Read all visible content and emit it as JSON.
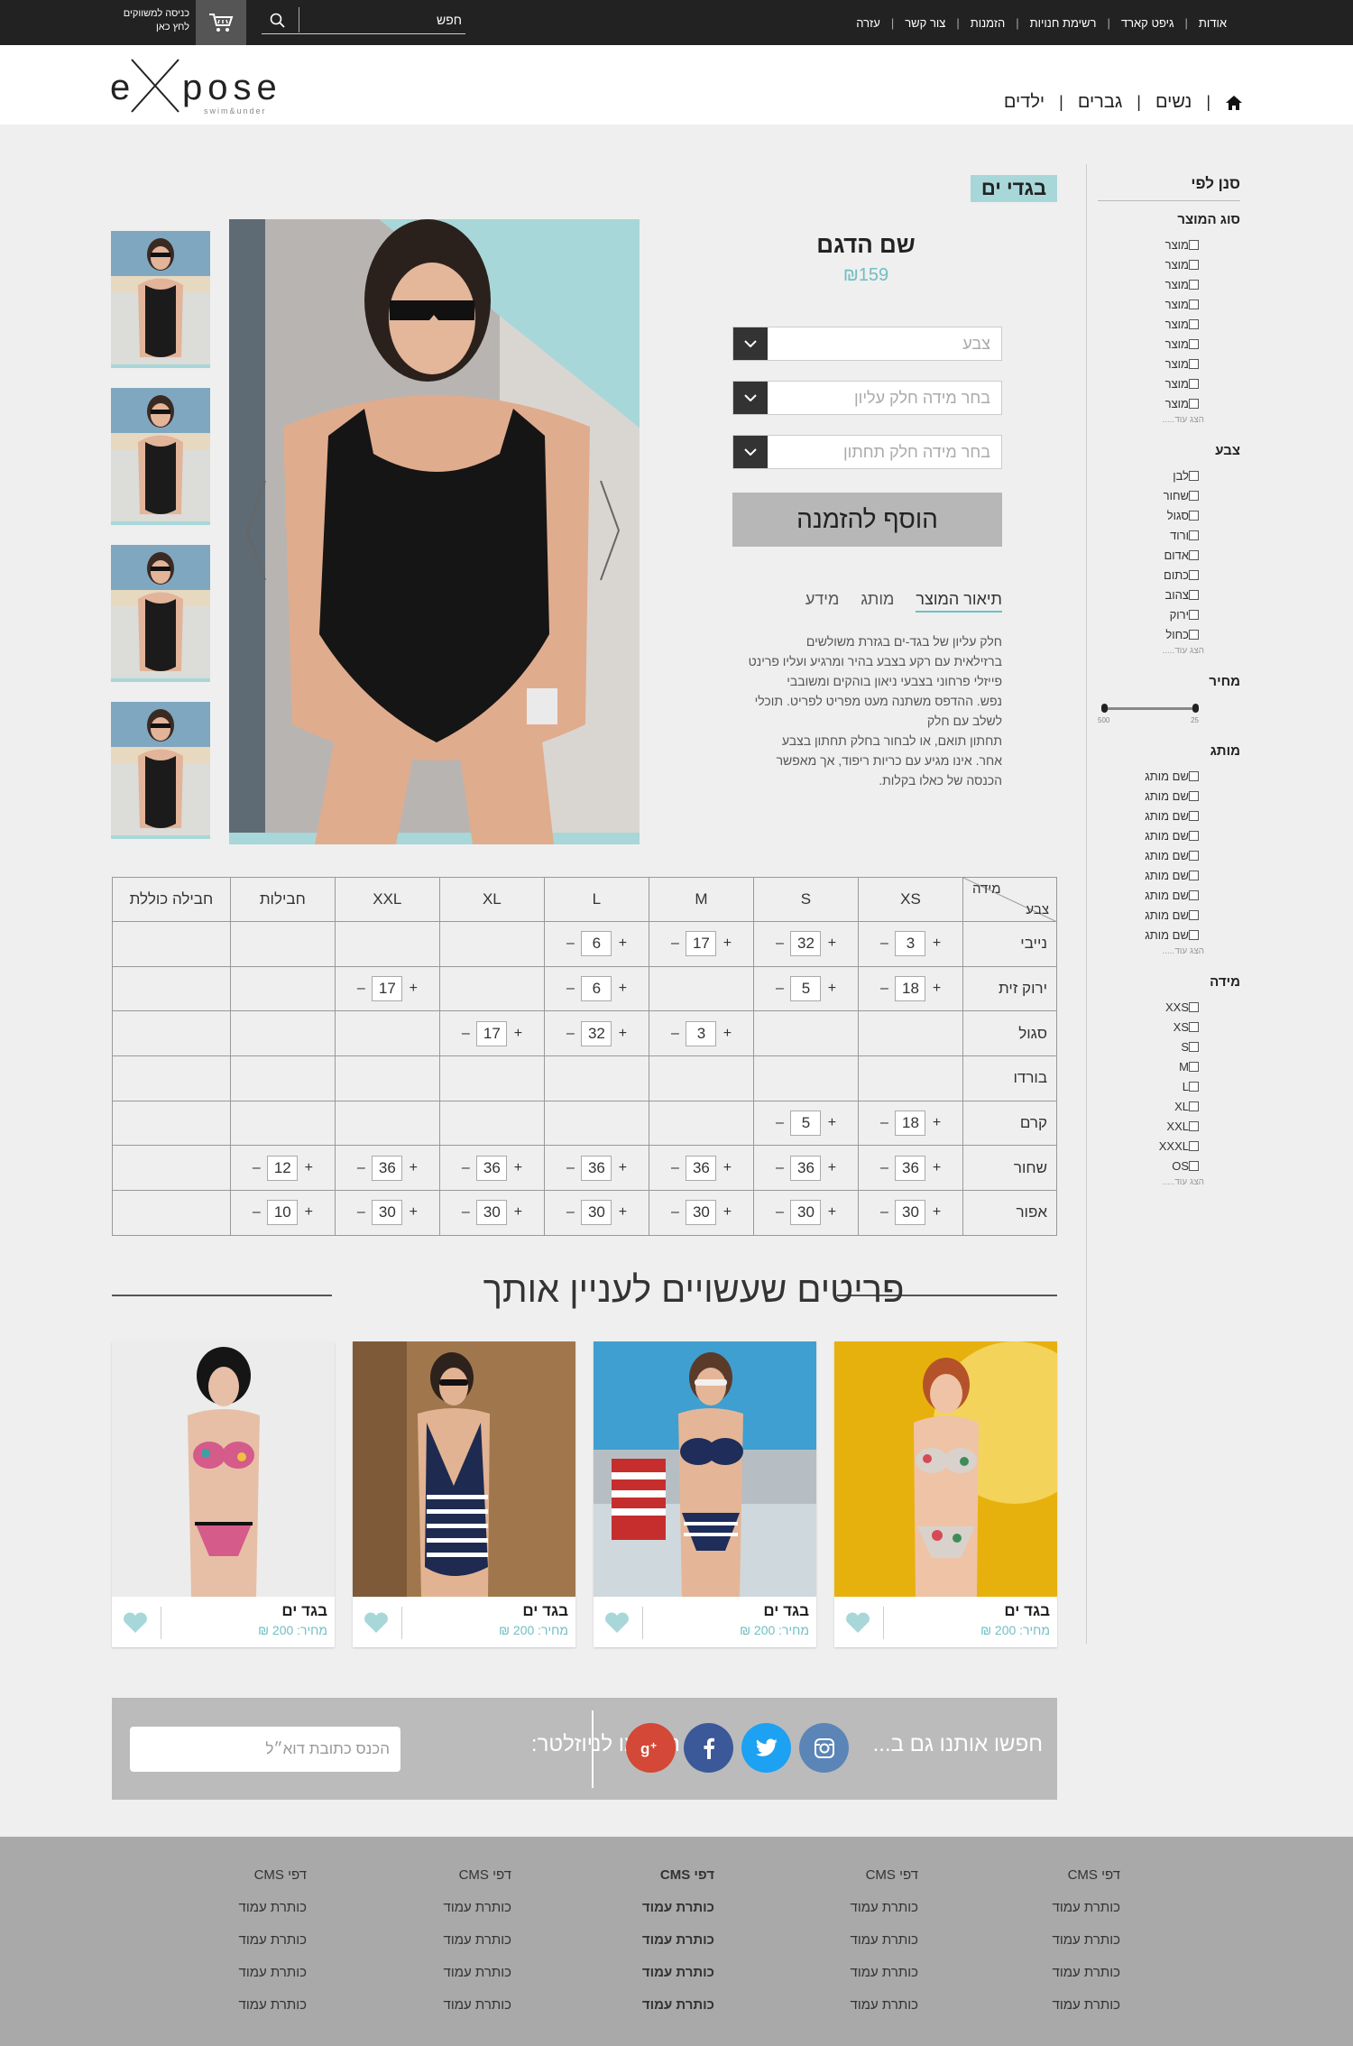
{
  "topbar": {
    "nav": [
      "אודות",
      "גיפט קארד",
      "רשימת חנויות",
      "הזמנות",
      "צור קשר",
      "עזרה"
    ],
    "search_placeholder": "חפש",
    "login_line1": "כניסה למשווקים",
    "login_line2": "לחץ כאן"
  },
  "header": {
    "logo_text": "expose",
    "logo_tagline": "swim&under",
    "nav": [
      "נשים",
      "גברים",
      "ילדים"
    ]
  },
  "sidebar": {
    "title": "סנן לפי",
    "product_type": {
      "label": "סוג המוצר",
      "items": [
        "מוצר",
        "מוצר",
        "מוצר",
        "מוצר",
        "מוצר",
        "מוצר",
        "מוצר",
        "מוצר",
        "מוצר"
      ],
      "more": "הצג עוד....."
    },
    "color": {
      "label": "צבע",
      "items": [
        "לבן",
        "שחור",
        "סגול",
        "ורוד",
        "אדום",
        "כתום",
        "צהוב",
        "ירוק",
        "כחול"
      ],
      "more": "הצג עוד....."
    },
    "price": {
      "label": "מחיר",
      "min": "25",
      "max": "500"
    },
    "brand": {
      "label": "מותג",
      "items": [
        "שם מותג",
        "שם מותג",
        "שם מותג",
        "שם מותג",
        "שם מותג",
        "שם מותג",
        "שם מותג",
        "שם מותג",
        "שם מותג"
      ],
      "more": "הצג עוד....."
    },
    "size": {
      "label": "מידה",
      "items": [
        "XXS",
        "XS",
        "S",
        "M",
        "L",
        "XL",
        "XXL",
        "XXXL",
        "OS"
      ],
      "more": "הצג עוד....."
    }
  },
  "product": {
    "category": "בגדי ים",
    "title": "שם הדגם",
    "price": "₪159",
    "select_color": "צבע",
    "select_top": "בחר מידה חלק עליון",
    "select_bottom": "בחר מידה חלק תחתון",
    "add_button": "הוסף להזמנה",
    "tabs": [
      "תיאור המוצר",
      "מותג",
      "מידע"
    ],
    "description": [
      "חלק עליון של בגד-ים בגזרת משולשים",
      "ברזילאית עם רקע בצבע בהיר ומרגיע ועליו פרינט",
      "פייזלי פרחוני בצבעי ניאון בוהקים ומשובבי",
      "נפש. ההדפס משתנה מעט מפריט לפריט. תוכלי",
      "לשלב עם חלק",
      "תחתון תואם, או לבחור בחלק תחתון בצבע",
      "אחר. אינו מגיע עם כריות ריפוד, אך מאפשר",
      "הכנסה של כאלו בקלות."
    ]
  },
  "size_table": {
    "corner_size": "מידה",
    "corner_color": "צבע",
    "columns": [
      "XS",
      "S",
      "M",
      "L",
      "XL",
      "XXL",
      "חבילות",
      "חבילה כוללת"
    ],
    "rows": [
      {
        "color": "נייבי",
        "values": [
          "3",
          "32",
          "17",
          "6",
          "",
          "",
          "",
          ""
        ]
      },
      {
        "color": "ירוק זית",
        "values": [
          "18",
          "5",
          "",
          "6",
          "",
          "17",
          "",
          ""
        ]
      },
      {
        "color": "סגול",
        "values": [
          "",
          "",
          "3",
          "32",
          "17",
          "",
          "",
          ""
        ]
      },
      {
        "color": "בורדו",
        "values": [
          "",
          "",
          "",
          "",
          "",
          "",
          "",
          ""
        ]
      },
      {
        "color": "קרם",
        "values": [
          "18",
          "5",
          "",
          "",
          "",
          "",
          "",
          ""
        ]
      },
      {
        "color": "שחור",
        "values": [
          "36",
          "36",
          "36",
          "36",
          "36",
          "36",
          "12",
          ""
        ]
      },
      {
        "color": "אפור",
        "values": [
          "30",
          "30",
          "30",
          "30",
          "30",
          "30",
          "10",
          ""
        ]
      }
    ],
    "minus": "–",
    "plus": "+"
  },
  "related": {
    "title": "פריטים שעשויים לעניין אותך",
    "items": [
      {
        "name": "בגד ים",
        "price": "מחיר: 200 ₪"
      },
      {
        "name": "בגד ים",
        "price": "מחיר: 200 ₪"
      },
      {
        "name": "בגד ים",
        "price": "מחיר: 200 ₪"
      },
      {
        "name": "בגד ים",
        "price": "מחיר: 200 ₪"
      }
    ]
  },
  "newsletter": {
    "label": "הרשמו לניוזלטר:",
    "placeholder": "הכנס כתובת דוא״ל",
    "follow": "חפשו אותנו גם ב...",
    "social": [
      "instagram-icon",
      "twitter-icon",
      "facebook-icon",
      "google-plus-icon"
    ],
    "colors": {
      "instagram": "#5b85b7",
      "twitter": "#1da1f2",
      "facebook": "#3b5998",
      "google": "#d34836"
    }
  },
  "footer": {
    "columns": [
      [
        "דפי CMS",
        "כותרת עמוד",
        "כותרת עמוד",
        "כותרת עמוד",
        "כותרת עמוד"
      ],
      [
        "דפי CMS",
        "כותרת עמוד",
        "כותרת עמוד",
        "כותרת עמוד",
        "כותרת עמוד"
      ],
      [
        "דפי CMS",
        "כותרת עמוד",
        "כותרת עמוד",
        "כותרת עמוד",
        "כותרת עמוד"
      ],
      [
        "דפי CMS",
        "כותרת עמוד",
        "כותרת עמוד",
        "כותרת עמוד",
        "כותרת עמוד"
      ],
      [
        "דפי CMS",
        "כותרת עמוד",
        "כותרת עמוד",
        "כותרת עמוד",
        "כותרת עמוד"
      ]
    ]
  },
  "colors": {
    "accent": "#6fbfc3",
    "badge": "#a8d7d9",
    "dark": "#222222"
  }
}
